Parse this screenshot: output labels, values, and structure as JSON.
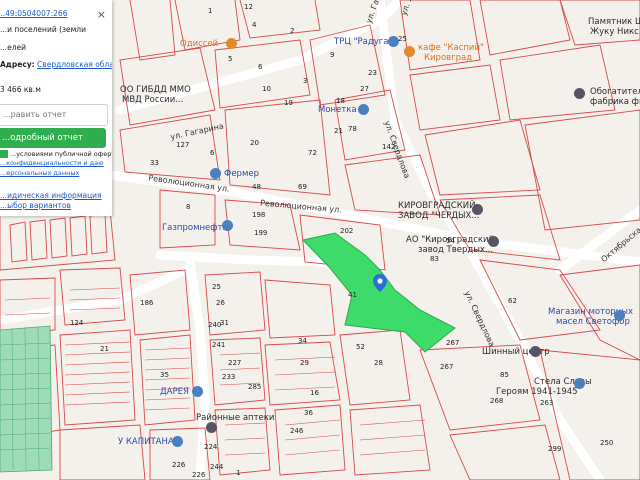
{
  "info_panel": {
    "cadastral_number": "...49:0504007:266",
    "category_line": "...и поселений (земли",
    "use_line": "...елей",
    "address_label": "Адресу:",
    "address_value": "Свердловская область, ...",
    "area": "3 466 кв.м",
    "input_placeholder": "...равить отчет",
    "report_button": "...одробный отчет",
    "terms_line1": "...условиями публичной оферты",
    "terms_line2": "...конфиденциальности и даю",
    "terms_line3": "...ерсональных данных",
    "legal_info": "...идическая информация",
    "options": "...ыбор вариантов"
  },
  "map": {
    "selected_parcel_color": "#3ddc6a",
    "boundary_color": "#d84a4a",
    "streets": [
      "ул. Гагарина",
      "ул. Гагарина",
      "ул. Ленина",
      "ул. Свердлова",
      "Революционная ул.",
      "Революционная ул.",
      "ул. Свердлова",
      "Октябрьская"
    ],
    "places": [
      "Памятник Штей...",
      "Жуку Никс...",
      "Одиссей",
      "ТРЦ \"Радуга\"",
      "кафе \"Каспий\"",
      "Кировград",
      "Обогатитель...",
      "фабрика фили...",
      "ОО ГИБДД ММО",
      "МВД России...",
      "Монетка",
      "Фермер",
      "КИРОВГРАДСКИЙ",
      "ЗАВОД \"ЧЕРДЫХ...",
      "АО \"Кировградский",
      "завод Твердых...",
      "Газпромнефть",
      "Магазин моторных",
      "масел Светофор",
      "Шинный центр",
      "Стела Славы",
      "Героям 1941-1945",
      "ДАРЕЯ",
      "Районные аптеки",
      "У КАПИТАНА"
    ],
    "parcel_numbers": [
      "1",
      "12",
      "4",
      "2",
      "9",
      "5",
      "6",
      "10",
      "3",
      "25",
      "23",
      "18",
      "19",
      "27",
      "78",
      "21",
      "142",
      "127",
      "33",
      "6",
      "20",
      "72",
      "48",
      "69",
      "198",
      "199",
      "202",
      "83",
      "54",
      "8",
      "25",
      "41",
      "186",
      "62",
      "267",
      "267",
      "26",
      "240",
      "31",
      "241",
      "34",
      "227",
      "233",
      "285",
      "29",
      "16",
      "36",
      "85",
      "263",
      "268",
      "299",
      "250",
      "124",
      "21",
      "35",
      "52",
      "28",
      "246",
      "224",
      "226",
      "244",
      "226",
      "1"
    ]
  }
}
